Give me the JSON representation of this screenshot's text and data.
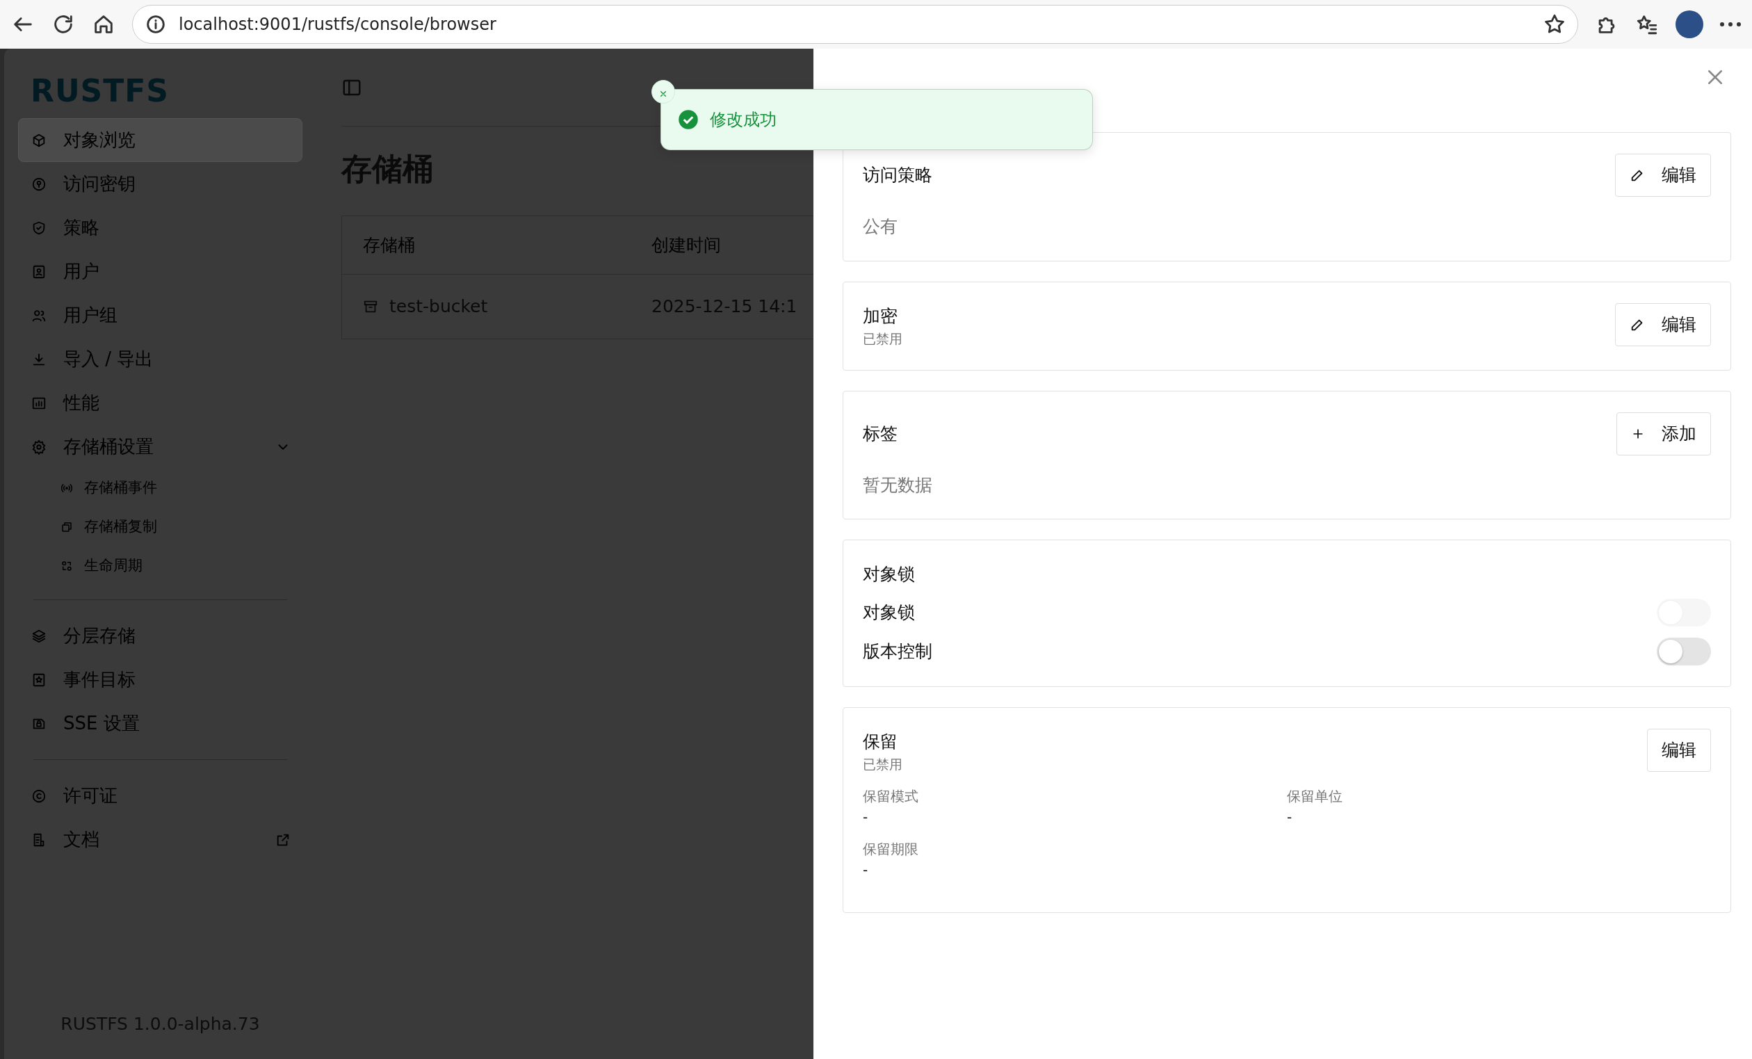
{
  "browser": {
    "url": "localhost:9001/rustfs/console/browser"
  },
  "sidebar": {
    "logo": "RUSTFS",
    "groups": [
      {
        "items": [
          {
            "label": "对象浏览",
            "selected": true
          },
          {
            "label": "访问密钥",
            "selected": false
          },
          {
            "label": "策略",
            "selected": false
          },
          {
            "label": "用户",
            "selected": false
          },
          {
            "label": "用户组",
            "selected": false
          },
          {
            "label": "导入 / 导出",
            "selected": false
          },
          {
            "label": "性能",
            "selected": false
          },
          {
            "label": "存储桶设置",
            "selected": false,
            "expanded": true,
            "children": [
              {
                "label": "存储桶事件",
                "selected": false
              },
              {
                "label": "存储桶复制",
                "selected": false
              },
              {
                "label": "生命周期",
                "selected": false
              }
            ]
          }
        ]
      },
      {
        "items": [
          {
            "label": "分层存储",
            "selected": false
          },
          {
            "label": "事件目标",
            "selected": false
          },
          {
            "label": "SSE 设置",
            "selected": false
          }
        ]
      },
      {
        "items": [
          {
            "label": "许可证",
            "selected": false
          },
          {
            "label": "文档",
            "selected": false,
            "external": true
          }
        ]
      }
    ],
    "version": "RUSTFS 1.0.0-alpha.73"
  },
  "main": {
    "page_title": "存储桶",
    "table": {
      "columns": [
        "存储桶",
        "创建时间"
      ],
      "rows": [
        [
          "test-bucket",
          "2025-12-15 14:1"
        ]
      ]
    }
  },
  "toast": {
    "message": "修改成功"
  },
  "drawer": {
    "sections": [
      {
        "kind": "value",
        "title": "访问策略",
        "button": {
          "kind": "edit",
          "label": "编辑"
        },
        "value": "公有"
      },
      {
        "kind": "status",
        "title": "加密",
        "subtitle": "已禁用",
        "button": {
          "kind": "edit",
          "label": "编辑"
        }
      },
      {
        "kind": "value",
        "title": "标签",
        "button": {
          "kind": "add",
          "label": "添加"
        },
        "value": "暂无数据"
      },
      {
        "kind": "toggles",
        "title": "对象锁",
        "toggles": [
          {
            "label": "对象锁",
            "on": false,
            "disabled": true
          },
          {
            "label": "版本控制",
            "on": false,
            "disabled": false
          }
        ]
      },
      {
        "kind": "fields",
        "title": "保留",
        "subtitle": "已禁用",
        "button": {
          "kind": "plain",
          "label": "编辑"
        },
        "fields": [
          {
            "label": "保留模式",
            "value": "-"
          },
          {
            "label": "保留单位",
            "value": "-"
          },
          {
            "label": "保留期限",
            "value": "-"
          }
        ]
      }
    ]
  }
}
